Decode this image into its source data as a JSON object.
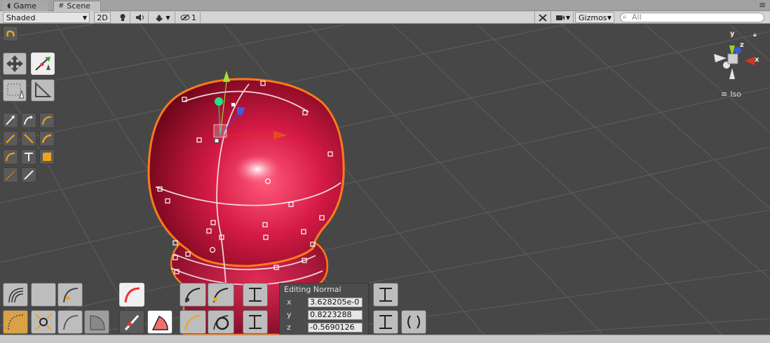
{
  "tabs": [
    {
      "label": "Game",
      "icon": "pacman-icon"
    },
    {
      "label": "Scene",
      "icon": "hash-icon"
    }
  ],
  "toolbar": {
    "shading_mode": "Shaded",
    "mode_2d": "2D",
    "hidden_count": "1",
    "gizmos_label": "Gizmos",
    "search_placeholder": "All"
  },
  "orientation_gizmo": {
    "axis_y": "y",
    "axis_z": "z",
    "axis_x": "x",
    "projection": "Iso",
    "colors": {
      "x": "#d8361c",
      "y": "#8fd32a",
      "z": "#3a5ad8"
    }
  },
  "mesh": {
    "fill": "#c8163c",
    "outline": "#ff7a1a"
  },
  "normal_panel": {
    "title": "Editing Normal",
    "x_label": "x",
    "x_value": "3.628205e-0",
    "y_label": "y",
    "y_value": "0.8223288",
    "z_label": "z",
    "z_value": "-0.5690126"
  }
}
